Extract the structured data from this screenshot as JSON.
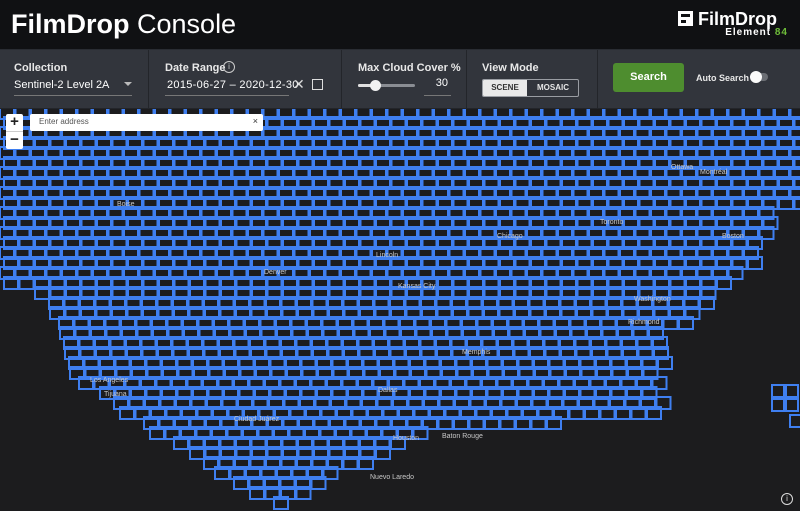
{
  "header": {
    "title_bold": "FilmDrop",
    "title_rest": "Console",
    "logo_word": "FilmDrop",
    "logo_sub_text": "Element",
    "logo_sub_number": "84"
  },
  "controls": {
    "collection": {
      "label": "Collection",
      "value": "Sentinel-2 Level 2A"
    },
    "date_range": {
      "label": "Date Range",
      "value": "2015-06-27 – 2020-12-30",
      "clear_glyph": "✕",
      "info_glyph": "i"
    },
    "cloud_cover": {
      "label": "Max Cloud Cover %",
      "value": "30",
      "slider_fraction": 0.3
    },
    "view_mode": {
      "label": "View Mode",
      "options": [
        "SCENE",
        "MOSAIC"
      ],
      "selected": "SCENE"
    },
    "search_button": "Search",
    "auto_search": {
      "label": "Auto Search",
      "enabled": false
    }
  },
  "map": {
    "zoom_in": "+",
    "zoom_out": "−",
    "address_placeholder": "Enter address",
    "address_clear": "×",
    "info_glyph": "i",
    "footprint_color": "#3f7ff0",
    "cities": [
      "Ottawa",
      "Montréal",
      "Boise",
      "Toronto",
      "Chicago",
      "Boston",
      "Lincoln",
      "Denver",
      "Kansas City",
      "Washington",
      "Richmond",
      "Los Angeles",
      "Tijuana",
      "Dallas",
      "Memphis",
      "Houston",
      "Baton Rouge",
      "Ciudad Juárez",
      "Nuevo Laredo"
    ]
  }
}
